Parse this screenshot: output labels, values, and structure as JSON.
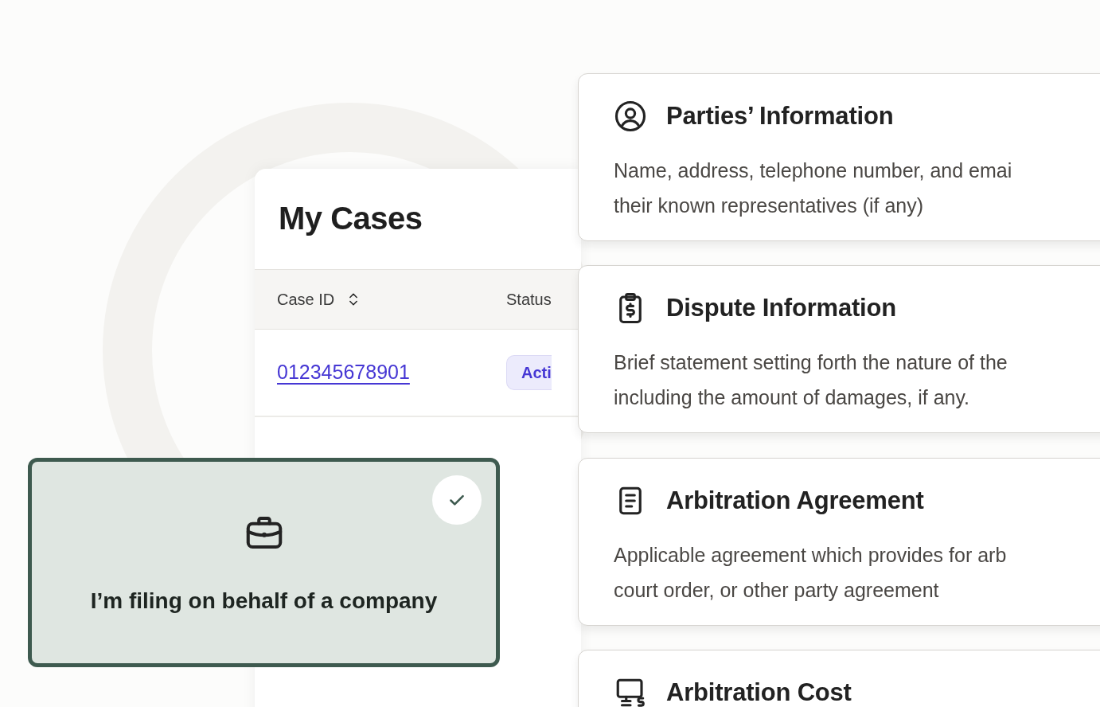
{
  "cases_panel": {
    "title": "My Cases",
    "columns": [
      {
        "label": "Case ID",
        "sortable": true
      },
      {
        "label": "Status",
        "sortable": false
      }
    ],
    "rows": [
      {
        "case_id": "012345678901",
        "status": "Acti"
      }
    ]
  },
  "filing_option": {
    "label": "I’m filing on behalf of a company",
    "selected": true
  },
  "sections": [
    {
      "kind": "person",
      "title": "Parties’ Information",
      "description": "Name, address, telephone number, and emai\ntheir known representatives (if any)"
    },
    {
      "kind": "clipboard",
      "title": "Dispute Information",
      "description": "Brief statement setting forth the nature of the\nincluding the amount of damages, if any."
    },
    {
      "kind": "document",
      "title": "Arbitration Agreement",
      "description": "Applicable agreement which provides for arb\ncourt order, or other party agreement"
    },
    {
      "kind": "monitor",
      "title": "Arbitration Cost"
    }
  ]
}
